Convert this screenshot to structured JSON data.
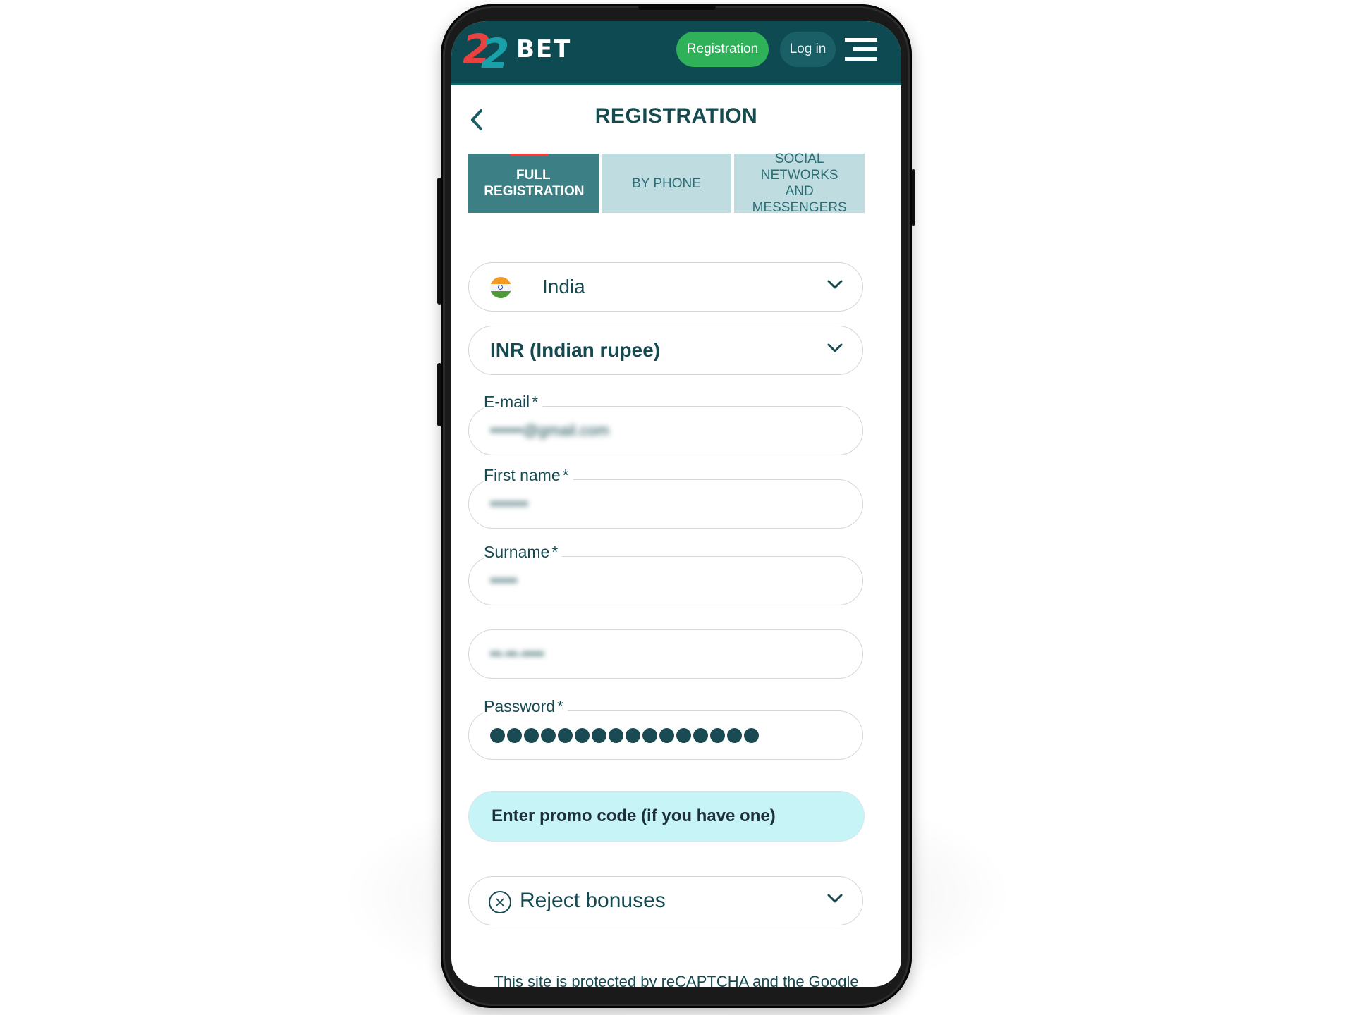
{
  "header": {
    "logo_digits": "22",
    "logo_text": "BET",
    "registration_label": "Registration",
    "login_label": "Log in"
  },
  "page": {
    "title": "REGISTRATION"
  },
  "tabs": [
    {
      "label": "FULL REGISTRATION",
      "active": true
    },
    {
      "label": "BY PHONE",
      "active": false
    },
    {
      "label": "SOCIAL NETWORKS AND MESSENGERS",
      "active": false
    }
  ],
  "form": {
    "country": {
      "value": "India",
      "flag": "india-flag"
    },
    "currency": {
      "value": "INR (Indian rupee)"
    },
    "email": {
      "label": "E-mail",
      "required_mark": "*",
      "value": "••••••@gmail.com",
      "blurred": true
    },
    "first_name": {
      "label": "First name",
      "required_mark": "*",
      "value": "•••••••",
      "blurred": true
    },
    "surname": {
      "label": "Surname",
      "required_mark": "*",
      "value": "•••••",
      "blurred": true
    },
    "date_of_birth": {
      "value": "••-••-••••",
      "blurred": true
    },
    "password": {
      "label": "Password",
      "required_mark": "*",
      "masked_length": 16
    },
    "promo_code": {
      "label": "Enter promo code (if you have one)"
    },
    "bonus": {
      "value": "Reject bonuses"
    }
  },
  "footer": {
    "recaptcha_text": "This site is protected by reCAPTCHA and the Google"
  },
  "colors": {
    "header_bg": "#0d4a51",
    "registration_button": "#2fb15a",
    "login_button": "#1b5f66",
    "tab_active": "#3c7f85",
    "tab_inactive": "#bfdde0",
    "text_primary": "#164a50",
    "promo_bg": "#c6f4f7",
    "logo_red": "#e8413f",
    "logo_teal": "#1aa0a8"
  }
}
